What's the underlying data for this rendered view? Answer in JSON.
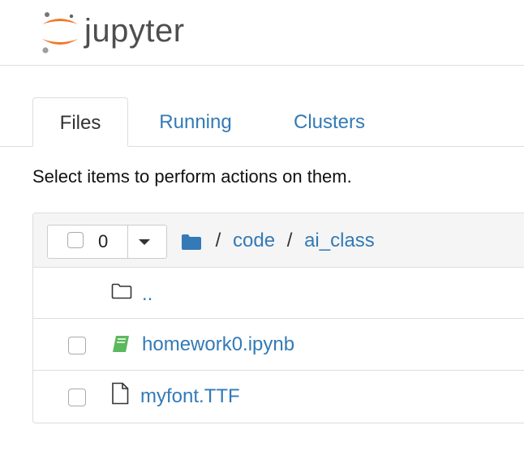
{
  "header": {
    "logo_text": "jupyter"
  },
  "tabs": [
    {
      "label": "Files",
      "active": true
    },
    {
      "label": "Running",
      "active": false
    },
    {
      "label": "Clusters",
      "active": false
    }
  ],
  "hint": "Select items to perform actions on them.",
  "toolbar": {
    "selected_count": "0"
  },
  "breadcrumb": {
    "separator": "/",
    "items": [
      "code",
      "ai_class"
    ]
  },
  "files": [
    {
      "name": "..",
      "icon": "folder-icon",
      "checkbox": false
    },
    {
      "name": "homework0.ipynb",
      "icon": "notebook-icon",
      "checkbox": true
    },
    {
      "name": "myfont.TTF",
      "icon": "file-icon",
      "checkbox": true
    }
  ],
  "colors": {
    "link": "#337ab7",
    "logo_orange": "#f37726",
    "notebook_green": "#5cb85c"
  }
}
